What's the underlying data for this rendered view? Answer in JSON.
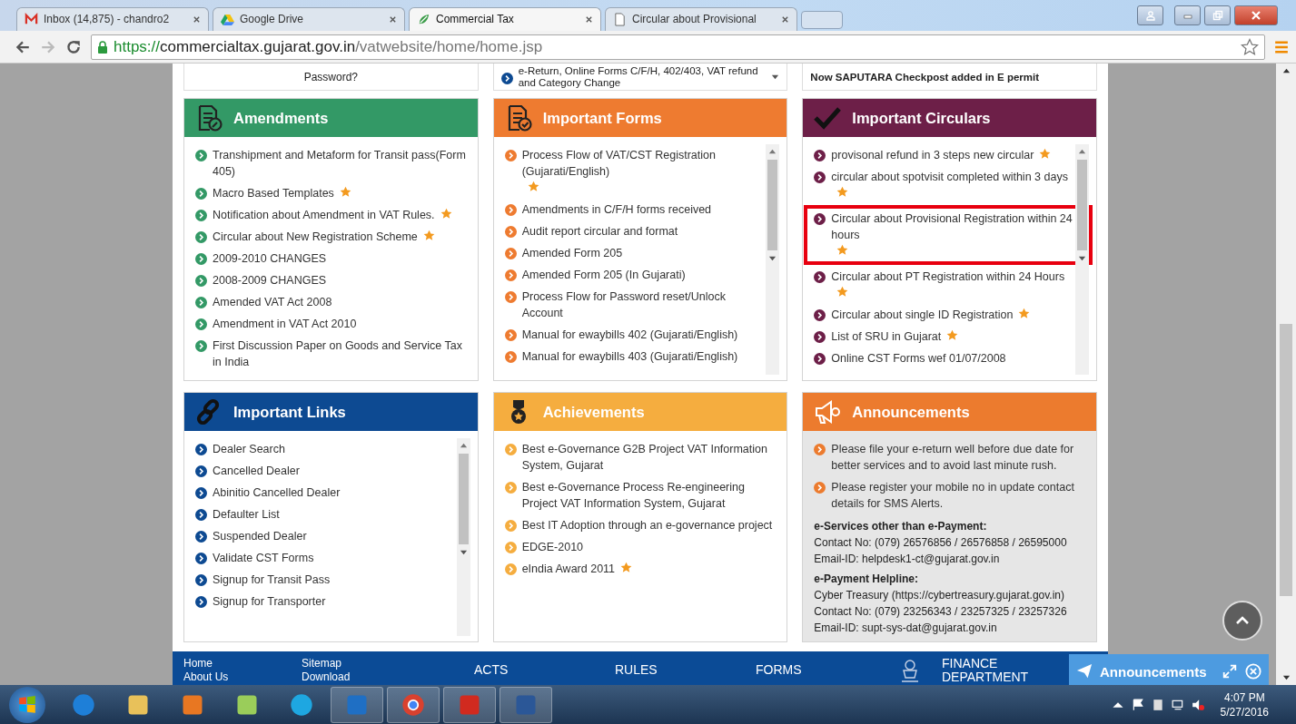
{
  "browser": {
    "tabs": [
      {
        "title": "Inbox (14,875) - chandro2",
        "selected": false
      },
      {
        "title": "Google Drive",
        "selected": false
      },
      {
        "title": "Commercial Tax",
        "selected": true
      },
      {
        "title": "Circular about Provisional",
        "selected": false
      }
    ],
    "url": {
      "scheme": "https://",
      "host": "commercialtax.gujarat.gov.in",
      "path": "/vatwebsite/home/home.jsp"
    }
  },
  "top_strip": [
    {
      "kind": "button",
      "text": "Password?"
    },
    {
      "kind": "bullet",
      "text": "e-Return, Online Forms C/F/H, 402/403, VAT refund and Category Change"
    },
    {
      "kind": "news",
      "text": "Now SAPUTARA Checkpost added in E permit"
    }
  ],
  "panels": [
    {
      "kind": "list",
      "title": "Amendments",
      "color": "#339966",
      "scrollable": false,
      "items": [
        {
          "text": "Transhipment and Metaform for Transit pass(Form 405)",
          "star": false
        },
        {
          "text": "Macro Based Templates",
          "star": true
        },
        {
          "text": "Notification about Amendment in VAT Rules.",
          "star": true
        },
        {
          "text": "Circular about New Registration Scheme",
          "star": true
        },
        {
          "text": "2009-2010 CHANGES",
          "star": false
        },
        {
          "text": "2008-2009 CHANGES",
          "star": false
        },
        {
          "text": "Amended VAT Act 2008",
          "star": false
        },
        {
          "text": "Amendment in VAT Act 2010",
          "star": false
        },
        {
          "text": "First Discussion Paper on Goods and Service Tax in India",
          "star": false
        }
      ]
    },
    {
      "kind": "list",
      "title": "Important Forms",
      "color": "#ee7b30",
      "scrollable": true,
      "items": [
        {
          "text": "Process Flow of VAT/CST Registration (Gujarati/English)",
          "star": true
        },
        {
          "text": "Amendments in C/F/H forms received",
          "star": false
        },
        {
          "text": "Audit report circular and format",
          "star": false
        },
        {
          "text": "Amended Form 205",
          "star": false
        },
        {
          "text": "Amended Form 205 (In Gujarati)",
          "star": false
        },
        {
          "text": "Process Flow for Password reset/Unlock Account",
          "star": false
        },
        {
          "text": "Manual for ewaybills 402 (Gujarati/English)",
          "star": false
        },
        {
          "text": "Manual for ewaybills 403 (Gujarati/English)",
          "star": false
        }
      ]
    },
    {
      "kind": "list",
      "title": "Important Circulars",
      "color": "#6d1f48",
      "scrollable": true,
      "items": [
        {
          "text": "provisonal refund in 3 steps new circular",
          "star": true,
          "highlighted": false
        },
        {
          "text": "circular about spotvisit completed within 3 days",
          "star": true,
          "highlighted": false
        },
        {
          "text": "Circular about Provisional Registration within 24 hours",
          "star": true,
          "highlighted": true
        },
        {
          "text": "Circular about PT Registration within 24 Hours",
          "star": true,
          "highlighted": false
        },
        {
          "text": "Circular about single ID Registration",
          "star": true,
          "highlighted": false
        },
        {
          "text": "List of SRU in Gujarat",
          "star": true,
          "highlighted": false
        },
        {
          "text": "Online CST Forms wef 01/07/2008",
          "star": false,
          "highlighted": false
        }
      ]
    },
    {
      "kind": "list",
      "title": "Important Links",
      "color": "#0d4a92",
      "scrollable": true,
      "items": [
        {
          "text": "Dealer Search",
          "star": false
        },
        {
          "text": "Cancelled Dealer",
          "star": false
        },
        {
          "text": "Abinitio Cancelled Dealer",
          "star": false
        },
        {
          "text": "Defaulter List",
          "star": false
        },
        {
          "text": "Suspended Dealer",
          "star": false
        },
        {
          "text": "Validate CST Forms",
          "star": false
        },
        {
          "text": "Signup for Transit Pass",
          "star": false
        },
        {
          "text": "Signup for Transporter",
          "star": false
        }
      ]
    },
    {
      "kind": "list",
      "title": "Achievements",
      "color": "#f5ad3f",
      "scrollable": false,
      "items": [
        {
          "text": "Best e-Governance G2B Project VAT Information System, Gujarat",
          "star": false
        },
        {
          "text": "Best e-Governance Process Re-engineering Project VAT Information System, Gujarat",
          "star": false
        },
        {
          "text": "Best IT Adoption through an e-governance project",
          "star": false
        },
        {
          "text": "EDGE-2010",
          "star": false
        },
        {
          "text": "eIndia Award 2011",
          "star": true
        }
      ]
    },
    {
      "kind": "notice",
      "title": "Announcements",
      "color": "#ec7b2e",
      "scrollable": false,
      "items": [
        {
          "text": "Please file your e-return well before due date for better services and to avoid last minute rush.",
          "star": false
        },
        {
          "text": "Please register your mobile no in update contact details for SMS Alerts.",
          "star": false
        }
      ],
      "contacts": [
        {
          "heading": "e-Services other than e-Payment:",
          "lines": [
            "Contact No: (079) 26576856 / 26576858 / 26595000",
            "Email-ID: helpdesk1-ct@gujarat.gov.in"
          ]
        },
        {
          "heading": "e-Payment Helpline:",
          "lines": [
            "Cyber Treasury (https://cybertreasury.gujarat.gov.in)",
            "Contact No: (079) 23256343 / 23257325 / 23257326",
            "Email-ID: supt-sys-dat@gujarat.gov.in"
          ]
        }
      ]
    }
  ],
  "footer": {
    "link_columns": [
      [
        "Home",
        "About Us"
      ],
      [
        "Sitemap",
        "Download"
      ]
    ],
    "headings": [
      "ACTS",
      "RULES",
      "FORMS"
    ],
    "department": [
      "FINANCE",
      "DEPARTMENT"
    ]
  },
  "announcements_bar": {
    "label": "Announcements"
  },
  "taskbar": {
    "time": "4:07 PM",
    "date": "5/27/2016"
  }
}
